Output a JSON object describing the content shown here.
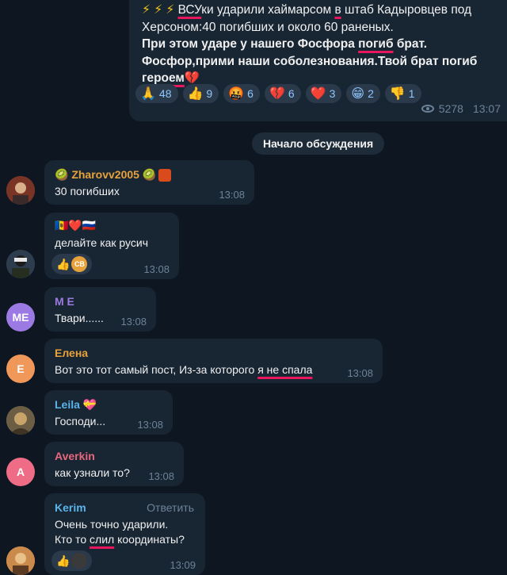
{
  "post": {
    "line1_prefix": "⚡ ⚡ ⚡ ",
    "line1_ul1": "ВСУ",
    "line1_mid": "ки ударили хаймарсом ",
    "line1_ul2": "в",
    "line1_end": " штаб Кадыровцев под",
    "line2": "Херсоном:40 погибших и около 60 раненых.",
    "line3_pre": "При этом ударе у нашего Фосфора ",
    "line3_ul": "погиб",
    "line3_end": " брат.",
    "line4": "Фосфор,прими наши соболезнования.Твой брат погиб",
    "line5_ul": "героем",
    "line5_emoji": "💔",
    "reactions": [
      {
        "emoji": "🙏",
        "count": "48"
      },
      {
        "emoji": "👍",
        "count": "9"
      },
      {
        "emoji": "🤬",
        "count": "6"
      },
      {
        "emoji": "💔",
        "count": "6"
      },
      {
        "emoji": "❤️",
        "count": "3"
      },
      {
        "emoji": "😁",
        "count": "2"
      },
      {
        "emoji": "👎",
        "count": "1"
      }
    ],
    "views": "5278",
    "time": "13:07"
  },
  "discussion_label": "Начало обсуждения",
  "comments": [
    {
      "name": "Zharovv2005",
      "name_color": "#e8a23b",
      "text": "30 погибших",
      "time": "13:08",
      "avatar_color": "#8b3a2e"
    },
    {
      "name_emoji": "🇲🇩❤️🇷🇺",
      "text": "делайте как русич",
      "time": "13:08",
      "avatar_color": "#33475a",
      "reaction_badge": "CB"
    },
    {
      "name": "M E",
      "name_color": "#9c7ae0",
      "text": "Твари......",
      "time": "13:08",
      "initials": "ME",
      "avatar_color": "#9b7be3"
    },
    {
      "name": "Елена",
      "name_color": "#e8a23b",
      "text_pre": "Вот это тот самый пост, Из-за которого ",
      "text_ul": "я не спала",
      "time": "13:08",
      "initials": "Е",
      "avatar_color": "#f0985a"
    },
    {
      "name": "Leila",
      "name_color": "#5ab4e8",
      "name_emoji": "💝",
      "text": "Господи...",
      "time": "13:08",
      "avatar_color": "#8a7a55"
    },
    {
      "name": "Averkin",
      "name_color": "#e8677d",
      "text": "как узнали то?",
      "time": "13:08",
      "initials": "A",
      "avatar_color": "#ef6c87"
    },
    {
      "name": "Kerim",
      "name_color": "#5ab4e8",
      "reply": "Ответить",
      "text1": "Очень точно ударили.",
      "text2_pre": "Кто то ",
      "text2_ul": "слил",
      "text2_end": " координаты?",
      "time": "13:09",
      "avatar_color": "#c98a4b"
    }
  ]
}
